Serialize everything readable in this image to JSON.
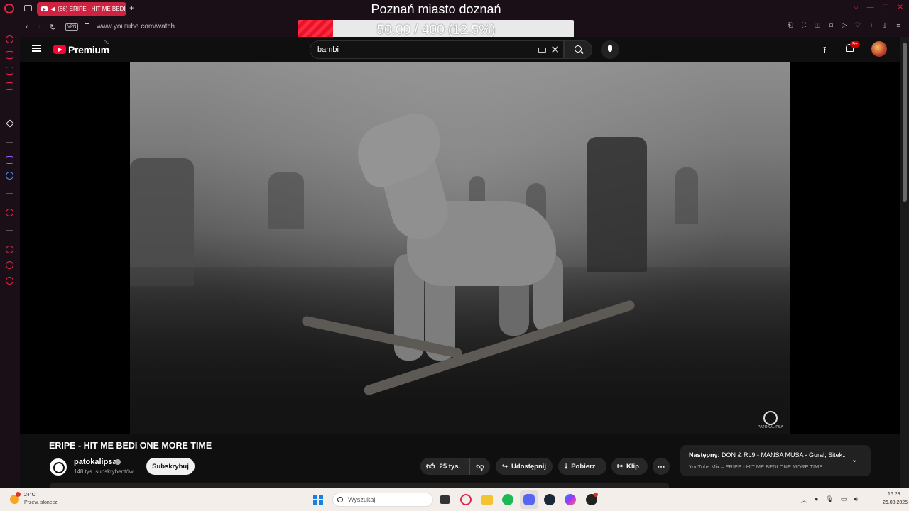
{
  "browser": {
    "tab_title": "(66) ERIPE - HIT ME BEDI",
    "url": "www.youtube.com/watch",
    "vpn_label": "VPN",
    "accent_color": "#e0264a"
  },
  "overlay": {
    "stream_title": "Poznań miasto doznań",
    "goal_text": "50.00 / 400 (12.5%)",
    "goal_current": 50.0,
    "goal_target": 400,
    "goal_fraction": 0.125
  },
  "youtube": {
    "brand": "Premium",
    "country": "PL",
    "search_value": "bambi",
    "notifications_badge": "9+",
    "video": {
      "title": "ERIPE - HIT ME BEDI ONE MORE TIME",
      "watermark": "PATOKALIPSA"
    },
    "channel": {
      "name": "patokalipsa",
      "subscribers": "148 tys. subskrybentów",
      "subscribe_label": "Subskrybuj"
    },
    "actions": {
      "likes": "25 tys.",
      "share": "Udostępnij",
      "download": "Pobierz",
      "clip": "Klip",
      "more": "⋯"
    },
    "up_next": {
      "label": "Następny:",
      "title": "DON & RL9 - MANSA MUSA - Gural, Sitek...",
      "subtitle": "YouTube Mix – ERIPE - HIT ME BEDI ONE MORE TIME"
    }
  },
  "taskbar": {
    "weather_temp": "24°C",
    "weather_desc": "Przew. słonecz.",
    "search_placeholder": "Wyszukaj",
    "time": "16:28",
    "date": "26.08.2025"
  }
}
